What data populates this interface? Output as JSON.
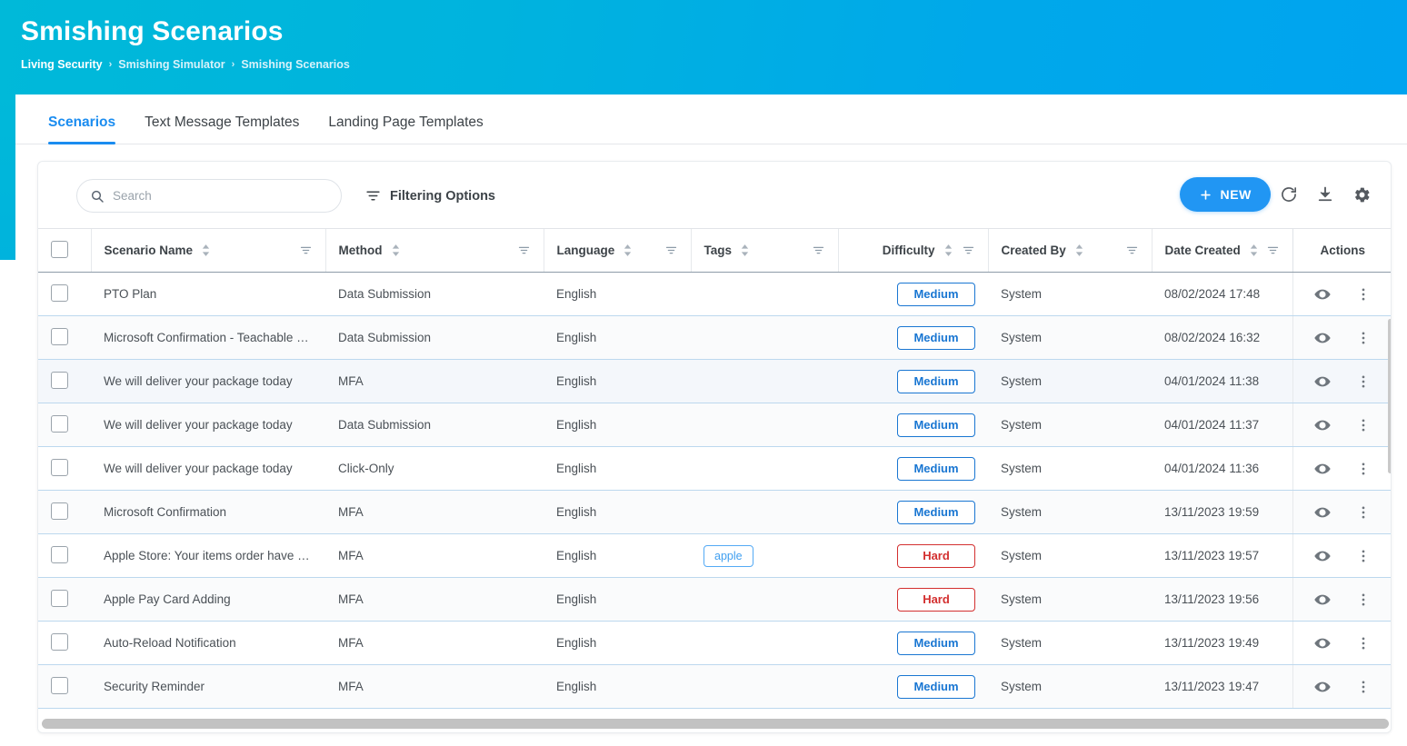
{
  "header": {
    "title": "Smishing Scenarios",
    "breadcrumb": [
      "Living Security",
      "Smishing Simulator",
      "Smishing Scenarios"
    ],
    "separator": "›",
    "gradient_from": "#00b9d9",
    "gradient_to": "#00a4ef"
  },
  "tabs": [
    {
      "label": "Scenarios",
      "active": true
    },
    {
      "label": "Text Message Templates",
      "active": false
    },
    {
      "label": "Landing Page Templates",
      "active": false
    }
  ],
  "toolbar": {
    "search_placeholder": "Search",
    "search_value": "",
    "search_icon": "search-icon",
    "filter_options_label": "Filtering Options",
    "filter_options_icon": "filter-icon",
    "new_button_label": "NEW",
    "new_button_icon": "plus-icon",
    "new_button_color": "#2196f3",
    "refresh_icon": "refresh-icon",
    "download_icon": "download-icon",
    "settings_icon": "gear-icon"
  },
  "table": {
    "select_all_checkbox": false,
    "columns": [
      {
        "key": "check",
        "label": "",
        "sortable": false,
        "filterable": false,
        "align": "left"
      },
      {
        "key": "name",
        "label": "Scenario Name",
        "sortable": true,
        "filterable": true,
        "align": "left"
      },
      {
        "key": "method",
        "label": "Method",
        "sortable": true,
        "filterable": true,
        "align": "left"
      },
      {
        "key": "language",
        "label": "Language",
        "sortable": true,
        "filterable": true,
        "align": "left"
      },
      {
        "key": "tags",
        "label": "Tags",
        "sortable": true,
        "filterable": true,
        "align": "left"
      },
      {
        "key": "difficulty",
        "label": "Difficulty",
        "sortable": true,
        "filterable": true,
        "align": "right"
      },
      {
        "key": "createdby",
        "label": "Created By",
        "sortable": true,
        "filterable": true,
        "align": "left"
      },
      {
        "key": "datecreated",
        "label": "Date Created",
        "sortable": true,
        "filterable": true,
        "align": "left"
      },
      {
        "key": "actions",
        "label": "Actions",
        "sortable": false,
        "filterable": false,
        "align": "center"
      }
    ],
    "rows": [
      {
        "name": "PTO Plan",
        "method": "Data Submission",
        "language": "English",
        "tags": "",
        "difficulty": "Medium",
        "difficulty_level": "medium",
        "created_by": "System",
        "date_created": "08/02/2024 17:48",
        "selected": false,
        "highlight": "none"
      },
      {
        "name": "Microsoft Confirmation - Teachable Mom…",
        "method": "Data Submission",
        "language": "English",
        "tags": "",
        "difficulty": "Medium",
        "difficulty_level": "medium",
        "created_by": "System",
        "date_created": "08/02/2024 16:32",
        "selected": false,
        "highlight": "alt"
      },
      {
        "name": "We will deliver your package today",
        "method": "MFA",
        "language": "English",
        "tags": "",
        "difficulty": "Medium",
        "difficulty_level": "medium",
        "created_by": "System",
        "date_created": "04/01/2024 11:38",
        "selected": false,
        "highlight": "hover"
      },
      {
        "name": "We will deliver your package today",
        "method": "Data Submission",
        "language": "English",
        "tags": "",
        "difficulty": "Medium",
        "difficulty_level": "medium",
        "created_by": "System",
        "date_created": "04/01/2024 11:37",
        "selected": false,
        "highlight": "alt"
      },
      {
        "name": "We will deliver your package today",
        "method": "Click-Only",
        "language": "English",
        "tags": "",
        "difficulty": "Medium",
        "difficulty_level": "medium",
        "created_by": "System",
        "date_created": "04/01/2024 11:36",
        "selected": false,
        "highlight": "none"
      },
      {
        "name": "Microsoft Confirmation",
        "method": "MFA",
        "language": "English",
        "tags": "",
        "difficulty": "Medium",
        "difficulty_level": "medium",
        "created_by": "System",
        "date_created": "13/11/2023 19:59",
        "selected": false,
        "highlight": "alt"
      },
      {
        "name": "Apple Store: Your items order have shipp…",
        "method": "MFA",
        "language": "English",
        "tags": "apple",
        "difficulty": "Hard",
        "difficulty_level": "hard",
        "created_by": "System",
        "date_created": "13/11/2023 19:57",
        "selected": false,
        "highlight": "none"
      },
      {
        "name": "Apple Pay Card Adding",
        "method": "MFA",
        "language": "English",
        "tags": "",
        "difficulty": "Hard",
        "difficulty_level": "hard",
        "created_by": "System",
        "date_created": "13/11/2023 19:56",
        "selected": false,
        "highlight": "alt"
      },
      {
        "name": "Auto-Reload Notification",
        "method": "MFA",
        "language": "English",
        "tags": "",
        "difficulty": "Medium",
        "difficulty_level": "medium",
        "created_by": "System",
        "date_created": "13/11/2023 19:49",
        "selected": false,
        "highlight": "none"
      },
      {
        "name": "Security Reminder",
        "method": "MFA",
        "language": "English",
        "tags": "",
        "difficulty": "Medium",
        "difficulty_level": "medium",
        "created_by": "System",
        "date_created": "13/11/2023 19:47",
        "selected": false,
        "highlight": "alt"
      }
    ],
    "row_action_icons": [
      "eye-icon",
      "more-vertical-icon"
    ],
    "sort_icon": "sort-arrows-icon",
    "filter_icon": "column-filter-icon"
  },
  "colors": {
    "accent_blue": "#1a8cf0",
    "badge_medium": "#1976d2",
    "badge_hard": "#d32f2f",
    "tag_blue": "#42a0f0",
    "row_divider": "#bcd8ee"
  }
}
